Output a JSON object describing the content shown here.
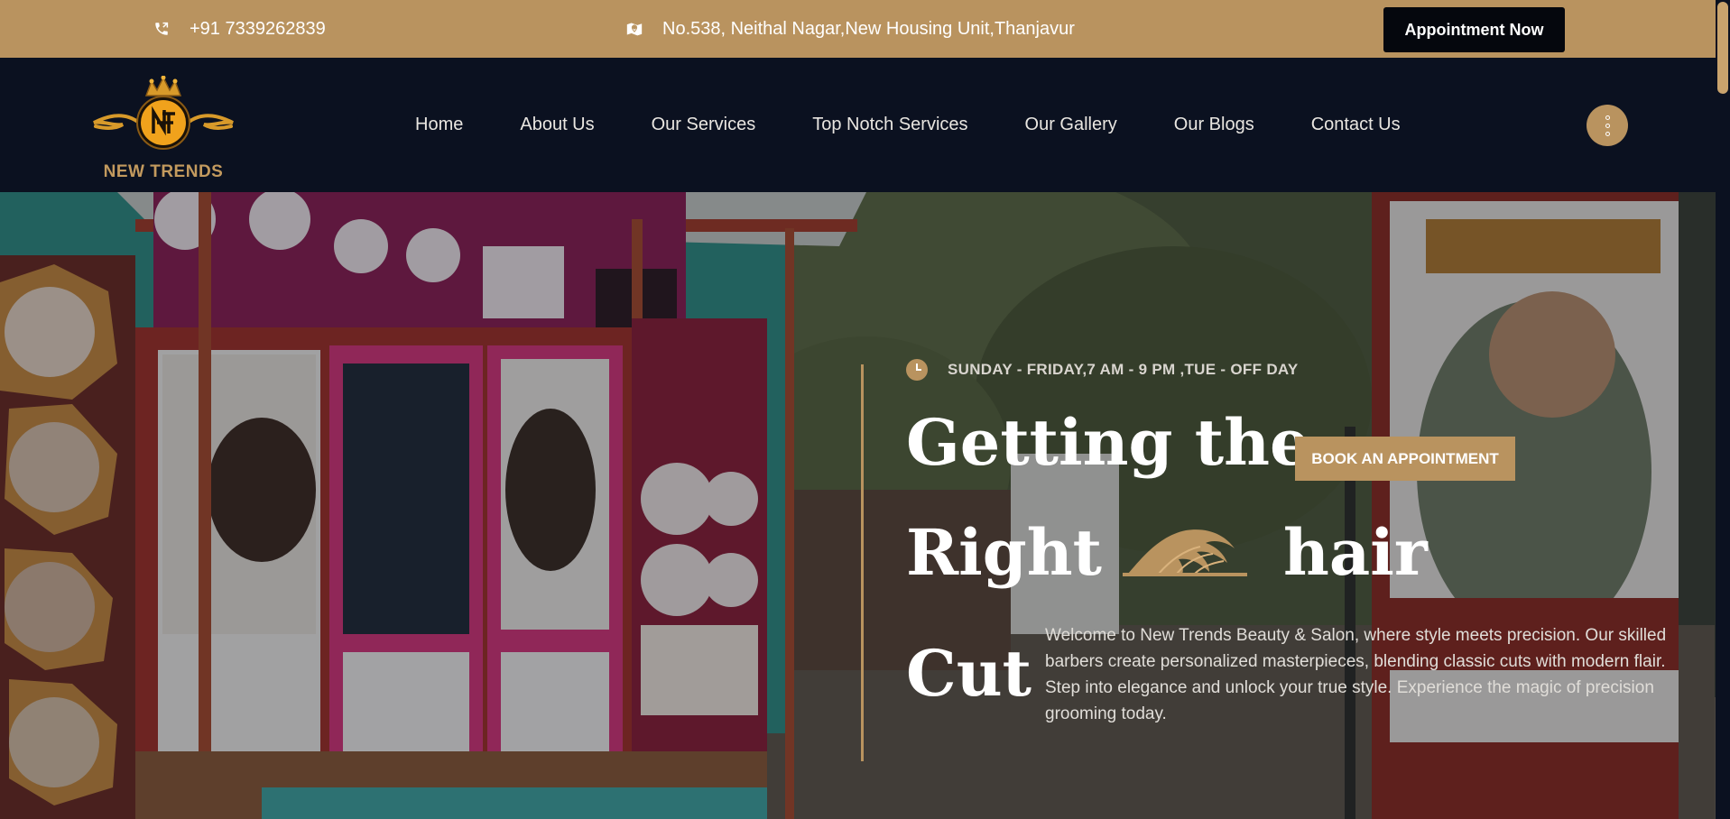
{
  "topbar": {
    "phone_icon": "phone-icon",
    "phone": "+91 7339262839",
    "address_icon": "map-icon",
    "address": "No.538, Neithal Nagar,New Housing Unit,Thanjavur",
    "appointment_label": "Appointment Now"
  },
  "brand": {
    "name": "NEW TRENDS",
    "logo_icon": "crown-logo-icon"
  },
  "nav": {
    "items": [
      "Home",
      "About Us",
      "Our Services",
      "Top Notch Services",
      "Our Gallery",
      "Our Blogs",
      "Contact Us"
    ],
    "more_icon": "more-vertical-icon"
  },
  "hero": {
    "hours": "SUNDAY - FRIDAY,7 AM - 9 PM ,TUE - OFF DAY",
    "hours_icon": "clock-icon",
    "heading_line1": "Getting the",
    "heading_line2a": "Right",
    "heading_line2b": "hair",
    "heading_line3": "Cut",
    "book_label": "BOOK AN APPOINTMENT",
    "description": "Welcome to New Trends Beauty & Salon, where style meets precision. Our skilled barbers create personalized masterpieces, blending classic cuts with modern flair. Step into elegance and unlock your true style. Experience the magic of precision grooming today."
  },
  "colors": {
    "gold": "#b9935f",
    "navy": "#0b1120",
    "black": "#05070d"
  }
}
